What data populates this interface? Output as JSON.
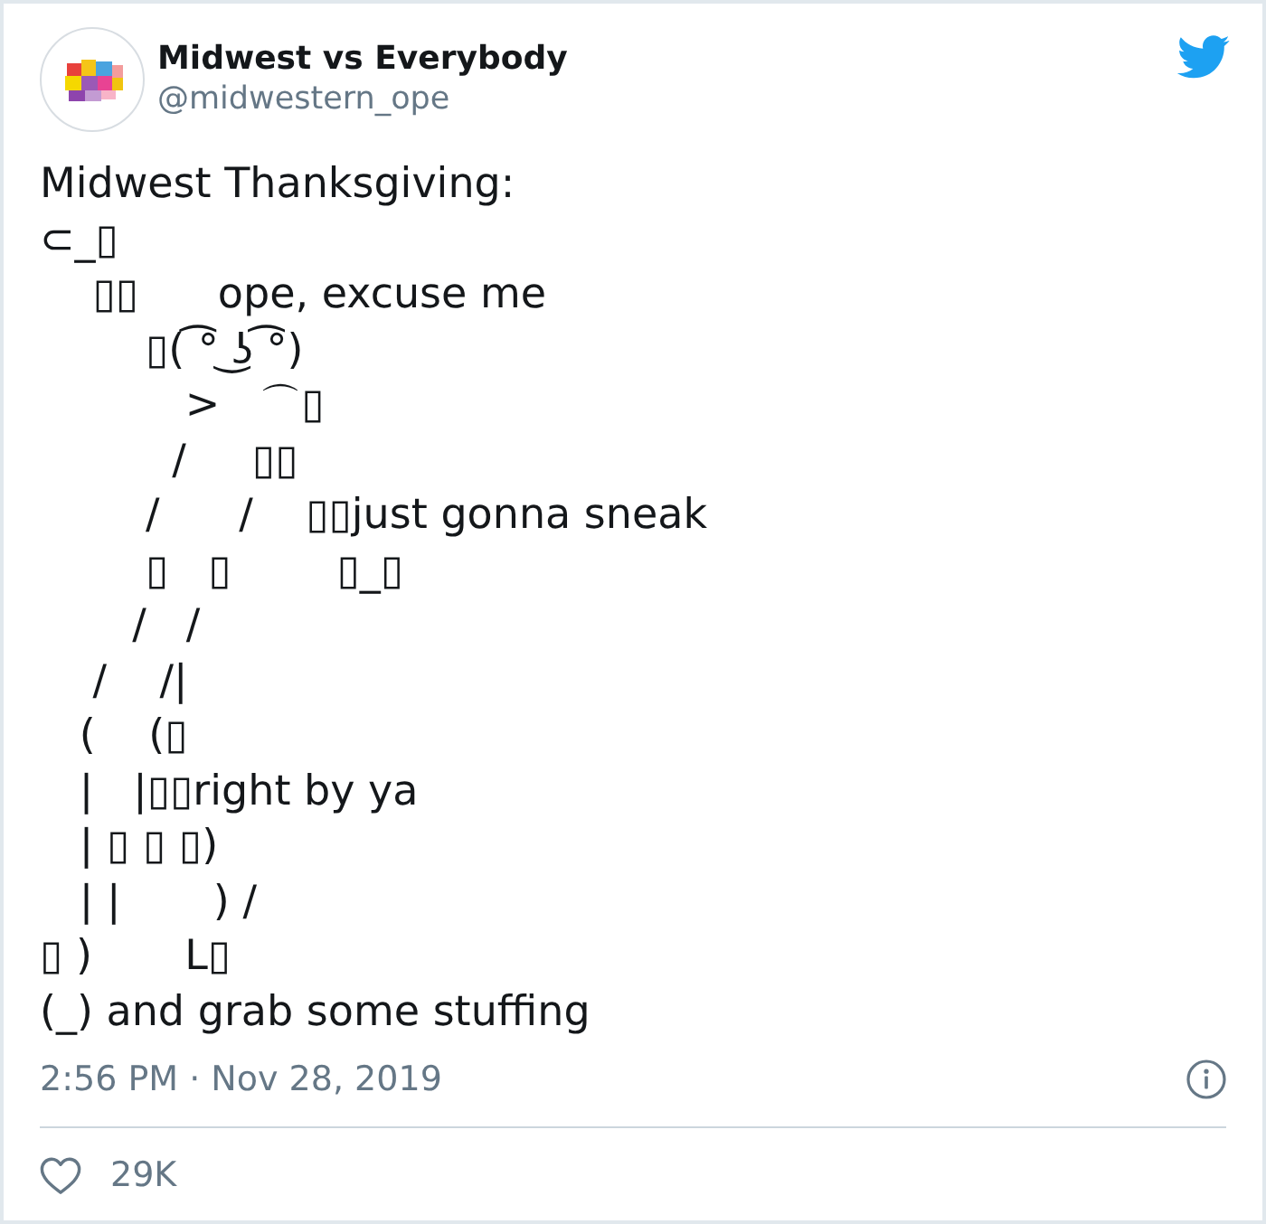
{
  "author": {
    "name": "Midwest vs Everybody",
    "handle": "@midwestern_ope"
  },
  "tweet": {
    "text": "Midwest Thanksgiving:\n⊂_▯\n    ▯▯      ope, excuse me\n        ▯( ͡° ͜ʖ ͡°)\n           >   ⌒▯\n          /     ▯▯\n        /      /    ▯▯just gonna sneak\n        ▯   ▯        ▯_▯\n       /   /\n    /    /|\n   (    (▯\n   |   |▯▯right by ya\n   | ▯ ▯ ▯)\n   | |       ) /\n▯ )       L▯\n(_) and grab some stuffing"
  },
  "timestamp": "2:56 PM · Nov 28, 2019",
  "likes": {
    "count": "29K"
  }
}
